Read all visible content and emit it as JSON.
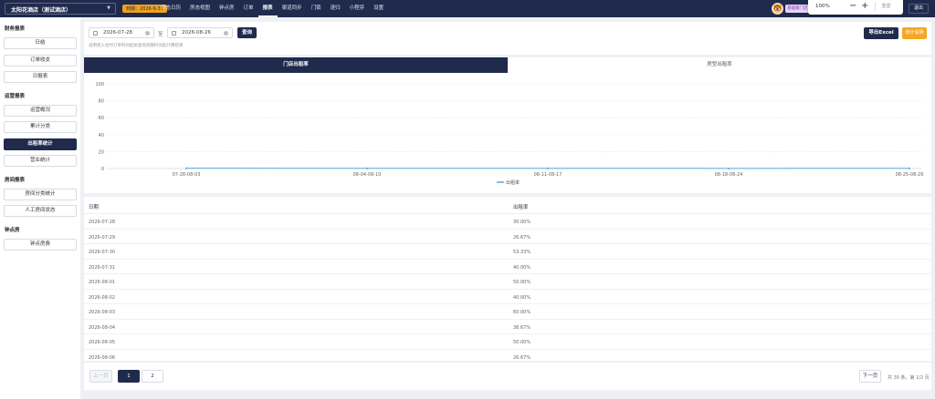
{
  "topbar": {
    "hotel": "太阳花酒店（测试酒店）",
    "expiry": "到期：2026-9-33",
    "nav": [
      "房态日历",
      "房态视图",
      "钟点房",
      "订单",
      "报表",
      "渠道同步",
      "门锁",
      "退归",
      "小程序",
      "设置"
    ],
    "nav_active": 4,
    "avatar_icon": "🐯",
    "user_tag": "基础版门店",
    "zoom": {
      "percent": "100%",
      "minus": "−",
      "plus": "+",
      "reset": "重置"
    },
    "logout": "退出"
  },
  "sidebar": {
    "groups": [
      {
        "title": "财务报表",
        "items": [
          "日结",
          "订单收支",
          "日报表"
        ]
      },
      {
        "title": "运营报表",
        "items": [
          "运营概况",
          "累计分类",
          "出租率统计",
          "营业统计"
        ],
        "active_item": 2
      },
      {
        "title": "房间报表",
        "items": [
          "房间分类统计",
          "人工房间状态"
        ]
      },
      {
        "title": "钟点房",
        "items": [
          "钟点房费"
        ]
      }
    ]
  },
  "filter": {
    "start_date": "2026-07-28",
    "separator": "至",
    "end_date": "2026-08-26",
    "query": "查询",
    "hint": "说明受入住时订单时间起始查询到期时间起计算结果",
    "export": "导出Excel",
    "explain": "统计说明"
  },
  "tabs": {
    "items": [
      "门店出租率",
      "房型出租率"
    ],
    "active": 0
  },
  "chart_data": {
    "type": "line",
    "y_ticks": [
      "100",
      "80",
      "60",
      "40",
      "20",
      "0"
    ],
    "ylim": [
      0,
      100
    ],
    "categories": [
      "07-28-08-03",
      "08-04-08-10",
      "08-11-08-17",
      "08-18-08-24",
      "08-25-08-26"
    ],
    "series": [
      {
        "name": "出租率",
        "values": [
          0.4,
          0.3,
          0.3,
          0.2,
          0.3
        ]
      }
    ],
    "legend": "bottom-center",
    "color": "#5aa8e0",
    "grid": true
  },
  "table": {
    "headers": [
      "日期",
      "出租率"
    ],
    "rows": [
      [
        "2026-07-28",
        "30.00%"
      ],
      [
        "2026-07-29",
        "26.67%"
      ],
      [
        "2026-07-30",
        "53.33%"
      ],
      [
        "2026-07-31",
        "40.00%"
      ],
      [
        "2026-08-01",
        "50.00%"
      ],
      [
        "2026-08-02",
        "40.00%"
      ],
      [
        "2026-08-03",
        "60.00%"
      ],
      [
        "2026-08-04",
        "36.67%"
      ],
      [
        "2026-08-05",
        "50.00%"
      ],
      [
        "2026-08-06",
        "26.67%"
      ]
    ]
  },
  "pager": {
    "prev": "上一页",
    "pages": [
      "1",
      "2"
    ],
    "active_page": 0,
    "next": "下一页",
    "info": "共 30 条，第 1/2 页"
  }
}
